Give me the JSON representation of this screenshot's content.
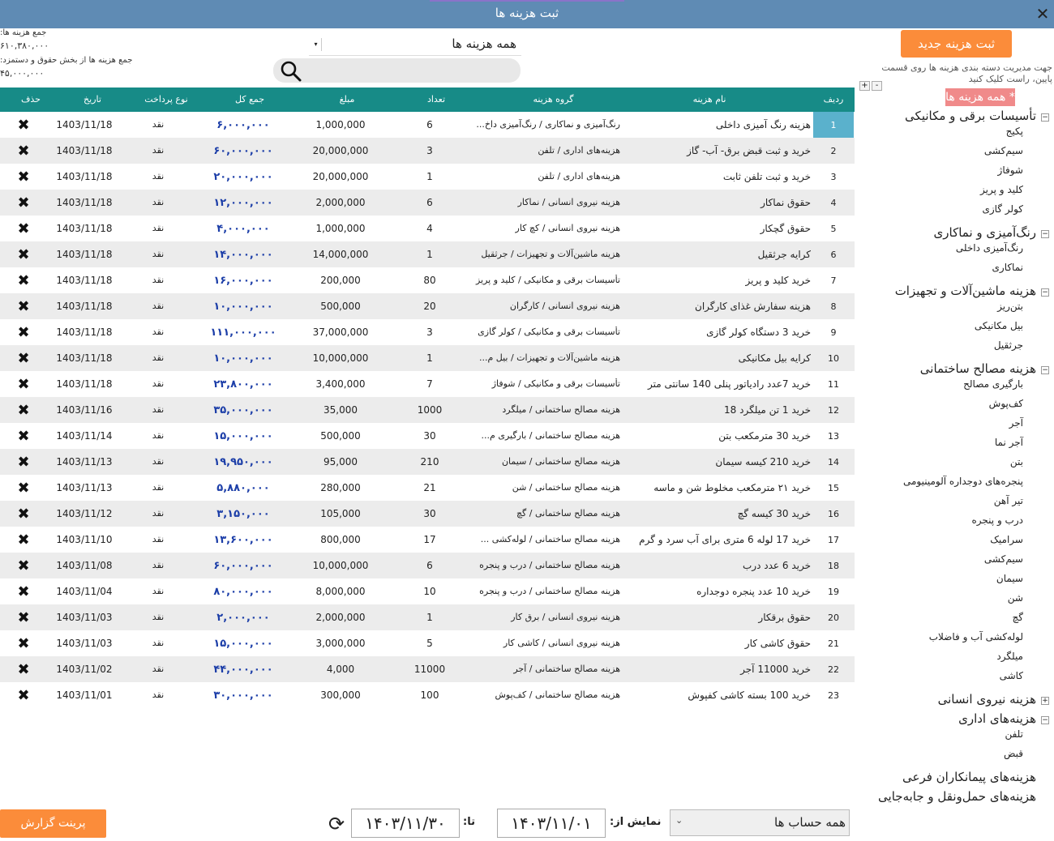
{
  "window": {
    "title": "ثبت هزینه ها",
    "close_label": "✕"
  },
  "summary": {
    "total_label": "جمع هزینه ها:",
    "total_value": "۶۱۰,۳۸۰,۰۰۰",
    "wages_label": "جمع هزینه ها از بخش حقوق و دستمزد:",
    "wages_value": "۴۵,۰۰۰,۰۰۰"
  },
  "filter": {
    "selected": "همه هزینه ها",
    "arrow": "▾"
  },
  "search": {
    "value": ""
  },
  "new_button": "ثبت هزینه جدید",
  "hint": "جهت مدیریت دسته بندی هزینه ها روی قسمت پایین، راست کلیک کنید",
  "tree_tools": [
    "+",
    "-"
  ],
  "table": {
    "headers": {
      "idx": "ردیف",
      "name": "نام هزینه",
      "group": "گروه هزینه",
      "count": "تعداد",
      "amount": "مبلغ",
      "total": "جمع کل",
      "pay": "نوع پرداخت",
      "date": "تاریخ",
      "del": "حذف"
    },
    "rows": [
      {
        "idx": "1",
        "name": "هزینه رنگ آمیزی داخلی",
        "group": "رنگ‌آمیزی و نماکاری / رنگ‌آمیزی داخ...",
        "count": "6",
        "amount": "1,000,000",
        "total": "۶,۰۰۰,۰۰۰",
        "pay": "نقد",
        "date": "1403/11/18"
      },
      {
        "idx": "2",
        "name": "خرید و ثبت قبض برق- آب- گاز",
        "group": "هزینه‌های اداری / تلفن",
        "count": "3",
        "amount": "20,000,000",
        "total": "۶۰,۰۰۰,۰۰۰",
        "pay": "نقد",
        "date": "1403/11/18"
      },
      {
        "idx": "3",
        "name": "خرید و ثبت تلفن ثابت",
        "group": "هزینه‌های اداری / تلفن",
        "count": "1",
        "amount": "20,000,000",
        "total": "۲۰,۰۰۰,۰۰۰",
        "pay": "نقد",
        "date": "1403/11/18"
      },
      {
        "idx": "4",
        "name": "حقوق نماکار",
        "group": "هزینه نیروی انسانی / نماکار",
        "count": "6",
        "amount": "2,000,000",
        "total": "۱۲,۰۰۰,۰۰۰",
        "pay": "نقد",
        "date": "1403/11/18"
      },
      {
        "idx": "5",
        "name": "حقوق گچکار",
        "group": "هزینه نیروی انسانی / کچ کار",
        "count": "4",
        "amount": "1,000,000",
        "total": "۴,۰۰۰,۰۰۰",
        "pay": "نقد",
        "date": "1403/11/18"
      },
      {
        "idx": "6",
        "name": "کرایه جرثقیل",
        "group": "هزینه ماشین‌آلات و تجهیزات / جرثقیل",
        "count": "1",
        "amount": "14,000,000",
        "total": "۱۴,۰۰۰,۰۰۰",
        "pay": "نقد",
        "date": "1403/11/18"
      },
      {
        "idx": "7",
        "name": "خرید کلید و پریز",
        "group": "تأسیسات برقی و مکانیکی / کلید و پریز",
        "count": "80",
        "amount": "200,000",
        "total": "۱۶,۰۰۰,۰۰۰",
        "pay": "نقد",
        "date": "1403/11/18"
      },
      {
        "idx": "8",
        "name": "هزینه سفارش غذای کارگران",
        "group": "هزینه نیروی انسانی / کارگران",
        "count": "20",
        "amount": "500,000",
        "total": "۱۰,۰۰۰,۰۰۰",
        "pay": "نقد",
        "date": "1403/11/18"
      },
      {
        "idx": "9",
        "name": "خرید 3 دستگاه کولر گازی",
        "group": "تأسیسات برقی و مکانیکی / کولر گازی",
        "count": "3",
        "amount": "37,000,000",
        "total": "۱۱۱,۰۰۰,۰۰۰",
        "pay": "نقد",
        "date": "1403/11/18"
      },
      {
        "idx": "10",
        "name": "کرایه بیل مکانیکی",
        "group": "هزینه ماشین‌آلات و تجهیزات / بیل م...",
        "count": "1",
        "amount": "10,000,000",
        "total": "۱۰,۰۰۰,۰۰۰",
        "pay": "نقد",
        "date": "1403/11/18"
      },
      {
        "idx": "11",
        "name": "خرید 7عدد رادیاتور پنلی 140 سانتی متر",
        "group": "تأسیسات برقی و مکانیکی / شوفاژ",
        "count": "7",
        "amount": "3,400,000",
        "total": "۲۳,۸۰۰,۰۰۰",
        "pay": "نقد",
        "date": "1403/11/18"
      },
      {
        "idx": "12",
        "name": "خرید 1 تن میلگرد 18",
        "group": "هزینه مصالح ساختمانی / میلگرد",
        "count": "1000",
        "amount": "35,000",
        "total": "۳۵,۰۰۰,۰۰۰",
        "pay": "نقد",
        "date": "1403/11/16"
      },
      {
        "idx": "13",
        "name": "خرید 30 مترمکعب بتن",
        "group": "هزینه مصالح ساختمانی / بارگیری م...",
        "count": "30",
        "amount": "500,000",
        "total": "۱۵,۰۰۰,۰۰۰",
        "pay": "نقد",
        "date": "1403/11/14"
      },
      {
        "idx": "14",
        "name": "خرید 210 کیسه سیمان",
        "group": "هزینه مصالح ساختمانی / سیمان",
        "count": "210",
        "amount": "95,000",
        "total": "۱۹,۹۵۰,۰۰۰",
        "pay": "نقد",
        "date": "1403/11/13"
      },
      {
        "idx": "15",
        "name": "خرید ۲۱ مترمکعب مخلوط شن و ماسه",
        "group": "هزینه مصالح ساختمانی / شن",
        "count": "21",
        "amount": "280,000",
        "total": "۵,۸۸۰,۰۰۰",
        "pay": "نقد",
        "date": "1403/11/13"
      },
      {
        "idx": "16",
        "name": "خرید 30 کیسه گچ",
        "group": "هزینه مصالح ساختمانی / گچ",
        "count": "30",
        "amount": "105,000",
        "total": "۳,۱۵۰,۰۰۰",
        "pay": "نقد",
        "date": "1403/11/12"
      },
      {
        "idx": "17",
        "name": "خرید 17 لوله 6 متری برای آب سرد و گرم",
        "group": "هزینه مصالح ساختمانی / لوله‌کشی ...",
        "count": "17",
        "amount": "800,000",
        "total": "۱۳,۶۰۰,۰۰۰",
        "pay": "نقد",
        "date": "1403/11/10"
      },
      {
        "idx": "18",
        "name": "خرید 6 عدد درب",
        "group": "هزینه مصالح ساختمانی / درب و پنجره",
        "count": "6",
        "amount": "10,000,000",
        "total": "۶۰,۰۰۰,۰۰۰",
        "pay": "نقد",
        "date": "1403/11/08"
      },
      {
        "idx": "19",
        "name": "خرید 10 عدد پنجره دوجداره",
        "group": "هزینه مصالح ساختمانی / درب و پنجره",
        "count": "10",
        "amount": "8,000,000",
        "total": "۸۰,۰۰۰,۰۰۰",
        "pay": "نقد",
        "date": "1403/11/04"
      },
      {
        "idx": "20",
        "name": "حقوق برقکار",
        "group": "هزینه نیروی انسانی / برق کار",
        "count": "1",
        "amount": "2,000,000",
        "total": "۲,۰۰۰,۰۰۰",
        "pay": "نقد",
        "date": "1403/11/03"
      },
      {
        "idx": "21",
        "name": "حقوق کاشی کار",
        "group": "هزینه نیروی انسانی / کاشی کار",
        "count": "5",
        "amount": "3,000,000",
        "total": "۱۵,۰۰۰,۰۰۰",
        "pay": "نقد",
        "date": "1403/11/03"
      },
      {
        "idx": "22",
        "name": "خرید 11000 آجر",
        "group": "هزینه مصالح ساختمانی / آجر",
        "count": "11000",
        "amount": "4,000",
        "total": "۴۴,۰۰۰,۰۰۰",
        "pay": "نقد",
        "date": "1403/11/02"
      },
      {
        "idx": "23",
        "name": "خرید 100 بسته کاشی کفپوش",
        "group": "هزینه مصالح ساختمانی / کف‌پوش",
        "count": "100",
        "amount": "300,000",
        "total": "۳۰,۰۰۰,۰۰۰",
        "pay": "نقد",
        "date": "1403/11/01"
      }
    ]
  },
  "tree": {
    "root": "* همه هزینه ها *",
    "nodes": [
      {
        "label": "تأسیسات برقی و مکانیکی",
        "expander": "−",
        "children": [
          "پکیج",
          "سیم‌کشی",
          "شوفاژ",
          "کلید و پریز",
          "کولر گازی"
        ]
      },
      {
        "label": "رنگ‌آمیزی و نماکاری",
        "expander": "−",
        "children": [
          "رنگ‌آمیزی داخلی",
          "نماکاری"
        ]
      },
      {
        "label": "هزینه ماشین‌آلات و تجهیزات",
        "expander": "−",
        "children": [
          "بتن‌ریز",
          "بیل مکانیکی",
          "جرثقیل"
        ]
      },
      {
        "label": "هزینه مصالح ساختمانی",
        "expander": "−",
        "children": [
          "بارگیری مصالح",
          "کف‌پوش",
          "آجر",
          "آجر نما",
          "بتن",
          "پنجره‌های دوجداره آلومینیومی",
          "تیر آهن",
          "درب و پنجره",
          "سرامیک",
          "سیم‌کشی",
          "سیمان",
          "شن",
          "گچ",
          "لوله‌کشی آب و فاضلاب",
          "میلگرد",
          "کاشی"
        ]
      },
      {
        "label": "هزینه نیروی انسانی",
        "expander": "+",
        "children": []
      },
      {
        "label": "هزینه‌های اداری",
        "expander": "−",
        "children": [
          "تلفن",
          "قبض"
        ]
      },
      {
        "label": "هزینه‌های پیمانکاران فرعی",
        "expander": "",
        "children": []
      },
      {
        "label": "هزینه‌های حمل‌ونقل و جابه‌جایی",
        "expander": "",
        "children": []
      }
    ]
  },
  "footer": {
    "print_label": "پرینت گزارش",
    "to_label": "تا:",
    "to_date": "۱۴۰۳/۱۱/۳۰",
    "from_label": "نمایش از:",
    "from_date": "۱۴۰۳/۱۱/۰۱",
    "account_selected": "همه حساب ها",
    "refresh_icon": "⟳",
    "account_arrow": "⌄"
  },
  "colors": {
    "titlebar": "#5f8bb4",
    "header": "#178b87",
    "accent_orange": "#fb8c3a",
    "selected_row_index": "#5ab1cc",
    "tree_root": "#f08a8a",
    "total_text": "#1c3ea8"
  },
  "icons": {
    "close": "close-icon",
    "search": "search-icon",
    "delete": "delete-icon",
    "refresh": "refresh-icon"
  }
}
